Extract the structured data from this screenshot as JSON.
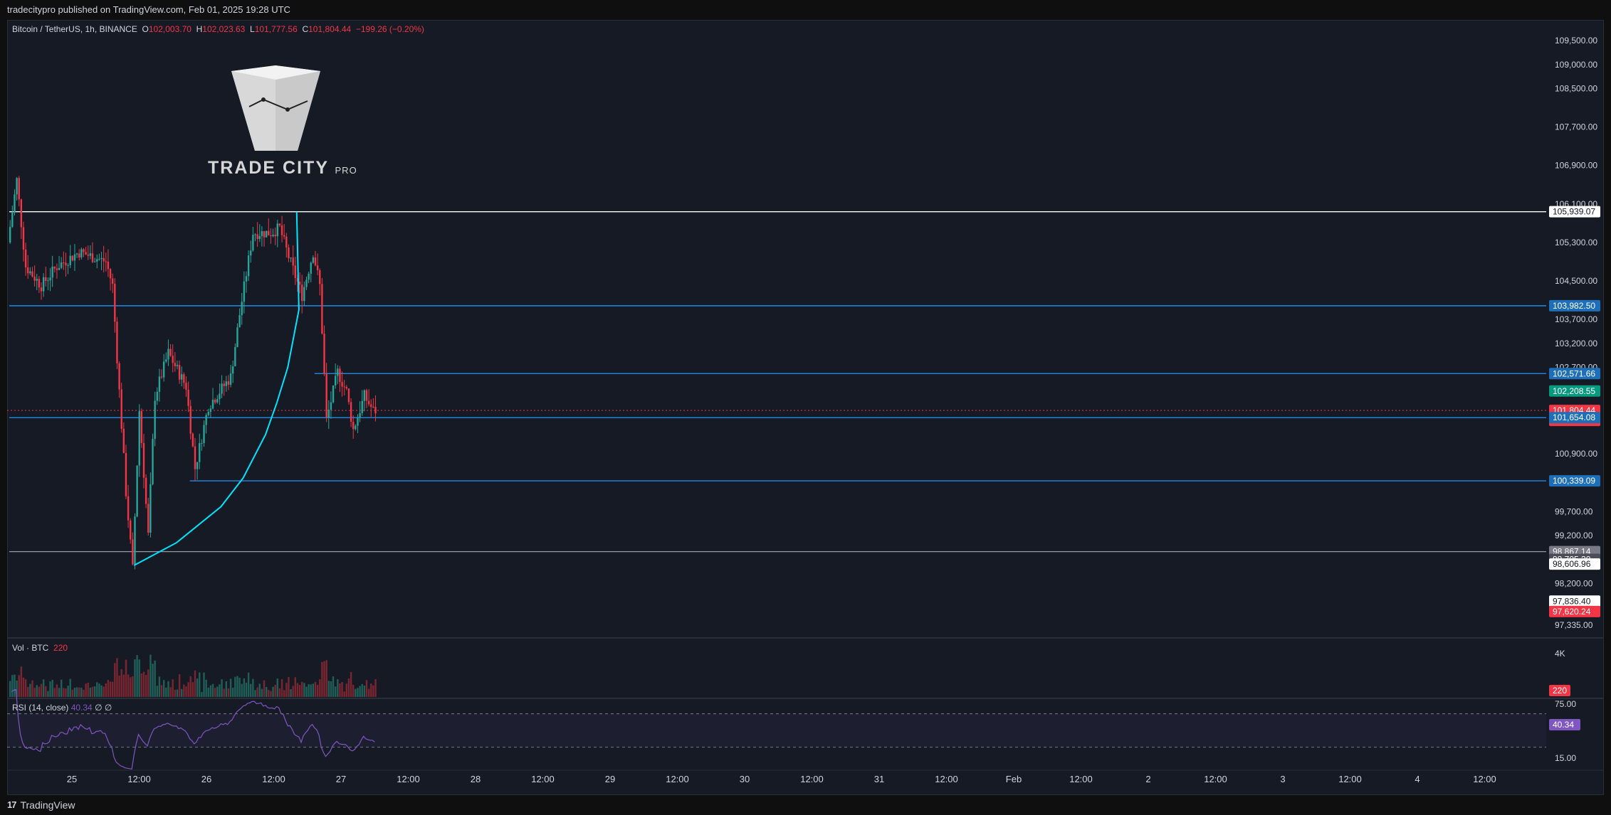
{
  "header": {
    "published": "tradecitypro published on TradingView.com, Feb 01, 2025 19:28 UTC"
  },
  "legend": {
    "symbol": "Bitcoin / TetherUS, 1h, BINANCE",
    "o_key": "O",
    "o_val": "102,003.70",
    "h_key": "H",
    "h_val": "102,023.63",
    "l_key": "L",
    "l_val": "101,777.56",
    "c_key": "C",
    "c_val": "101,804.44",
    "change": "−199.26 (−0.20%)"
  },
  "logo": {
    "name": "TRADE CITY",
    "suffix": "PRO"
  },
  "volume_pane": {
    "label": "Vol · BTC",
    "value": "220",
    "axis_label": "4K",
    "badge": "220"
  },
  "rsi_pane": {
    "label": "RSI (14, close)",
    "value": "40.34",
    "extra": "∅ ∅",
    "badge": "40.34",
    "upper": "75.00",
    "lower": "15.00"
  },
  "footer": {
    "brand": "TradingView"
  },
  "colors": {
    "up": "#26a69a",
    "down": "#f23645",
    "hline_blue": "#2962ff",
    "curve": "#00e5ff",
    "rsi": "#7e57c2"
  },
  "chart_data": {
    "type": "candlestick",
    "y_range": [
      97100,
      109900
    ],
    "y_ticks": [
      "109,500.00",
      "109,000.00",
      "108,500.00",
      "107,700.00",
      "106,900.00",
      "106,100.00",
      "105,300.00",
      "104,500.00",
      "103,700.00",
      "103,200.00",
      "102,700.00",
      "100,900.00",
      "99,700.00",
      "99,200.00",
      "98,200.00",
      "97,335.00"
    ],
    "y_tick_values": [
      109500,
      109000,
      108500,
      107700,
      106900,
      106100,
      105300,
      104500,
      103700,
      103200,
      102700,
      100900,
      99700,
      99200,
      98200,
      97335
    ],
    "x_ticks": [
      "25",
      "12:00",
      "26",
      "12:00",
      "27",
      "12:00",
      "28",
      "12:00",
      "29",
      "12:00",
      "30",
      "12:00",
      "31",
      "12:00",
      "Feb",
      "12:00",
      "2",
      "12:00",
      "3",
      "12:00",
      "4",
      "12:00"
    ],
    "price_labels": [
      {
        "text": "105,939.07",
        "value": 105939,
        "kind": "white"
      },
      {
        "text": "103,982.50",
        "value": 103982,
        "kind": "blue"
      },
      {
        "text": "102,571.66",
        "value": 102571,
        "kind": "blue"
      },
      {
        "text": "102,208.55",
        "value": 102208,
        "kind": "green"
      },
      {
        "text": "101,804.44",
        "value": 101804,
        "kind": "red",
        "sub": "31:07"
      },
      {
        "text": "101,654.08",
        "value": 101654,
        "kind": "blue"
      },
      {
        "text": "100,339.09",
        "value": 100339,
        "kind": "blue"
      },
      {
        "text": "98,867.14",
        "value": 98867,
        "kind": "gray"
      },
      {
        "text": "98,705.30",
        "value": 98705,
        "kind": "darkgray"
      },
      {
        "text": "98,606.96",
        "value": 98607,
        "kind": "white"
      },
      {
        "text": "97,836.40",
        "value": 97836,
        "kind": "white"
      },
      {
        "text": "97,620.24",
        "value": 97620,
        "kind": "red"
      }
    ],
    "hlines": [
      {
        "value": 105939,
        "color": "#ffffff",
        "from_hour": 0
      },
      {
        "value": 103982,
        "color": "#2196f3",
        "from_hour": 0
      },
      {
        "value": 102571,
        "color": "#2196f3",
        "from_hour": 137
      },
      {
        "value": 101654,
        "color": "#2196f3",
        "from_hour": 0
      },
      {
        "value": 100339,
        "color": "#2196f3",
        "from_hour": 81
      },
      {
        "value": 98867,
        "color": "#9598a1",
        "from_hour": 0
      }
    ],
    "curve_points": [
      [
        56,
        98580
      ],
      [
        75,
        99050
      ],
      [
        95,
        99800
      ],
      [
        105,
        100400
      ],
      [
        115,
        101300
      ],
      [
        120,
        101950
      ],
      [
        125,
        102700
      ],
      [
        130,
        103900
      ],
      [
        129,
        105939
      ]
    ],
    "anchors": [
      {
        "hour": 0,
        "price": 105300
      },
      {
        "hour": 4,
        "price": 106600
      },
      {
        "hour": 8,
        "price": 104800
      },
      {
        "hour": 15,
        "price": 104400
      },
      {
        "hour": 22,
        "price": 104800
      },
      {
        "hour": 32,
        "price": 105100
      },
      {
        "hour": 44,
        "price": 104900
      },
      {
        "hour": 47,
        "price": 104400
      },
      {
        "hour": 49,
        "price": 102900
      },
      {
        "hour": 53,
        "price": 100100
      },
      {
        "hour": 56,
        "price": 98500
      },
      {
        "hour": 59,
        "price": 101800
      },
      {
        "hour": 63,
        "price": 99200
      },
      {
        "hour": 66,
        "price": 102100
      },
      {
        "hour": 72,
        "price": 103000
      },
      {
        "hour": 80,
        "price": 102300
      },
      {
        "hour": 84,
        "price": 100600
      },
      {
        "hour": 90,
        "price": 101900
      },
      {
        "hour": 100,
        "price": 102500
      },
      {
        "hour": 104,
        "price": 103800
      },
      {
        "hour": 110,
        "price": 105500
      },
      {
        "hour": 118,
        "price": 105500
      },
      {
        "hour": 122,
        "price": 105600
      },
      {
        "hour": 126,
        "price": 105000
      },
      {
        "hour": 132,
        "price": 104200
      },
      {
        "hour": 137,
        "price": 105100
      },
      {
        "hour": 140,
        "price": 104400
      },
      {
        "hour": 143,
        "price": 101600
      },
      {
        "hour": 148,
        "price": 102600
      },
      {
        "hour": 152,
        "price": 102200
      },
      {
        "hour": 155,
        "price": 101400
      },
      {
        "hour": 160,
        "price": 102100
      },
      {
        "hour": 164,
        "price": 101800
      }
    ]
  }
}
